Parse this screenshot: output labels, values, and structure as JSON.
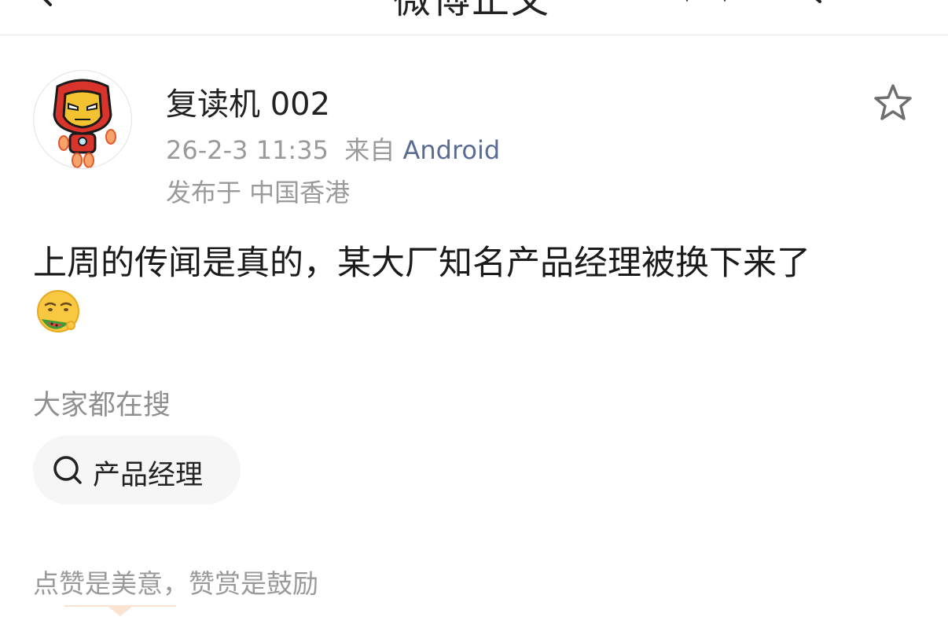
{
  "header": {
    "title_fragment": "微博正文"
  },
  "post": {
    "username": "复读机 002",
    "time": "26-2-3 11:35",
    "source_prefix": "来自",
    "source": "Android",
    "location": "发布于 中国香港",
    "text": "上周的传闻是真的，某大厂知名产品经理被换下来了"
  },
  "search_section": {
    "heading": "大家都在搜",
    "chip_label": "产品经理"
  },
  "reward": {
    "text": "点赞是美意，赞赏是鼓励"
  },
  "colors": {
    "source_link": "#5b6c93",
    "meta_gray": "#9a9a9a",
    "chip_bg": "#f6f6f6",
    "accent_orange": "#f6a36b"
  },
  "icons": [
    "back-arrow-icon",
    "more-icon",
    "search-icon",
    "avatar-ironman",
    "star-icon",
    "emoji-melon",
    "chip-search-icon"
  ]
}
